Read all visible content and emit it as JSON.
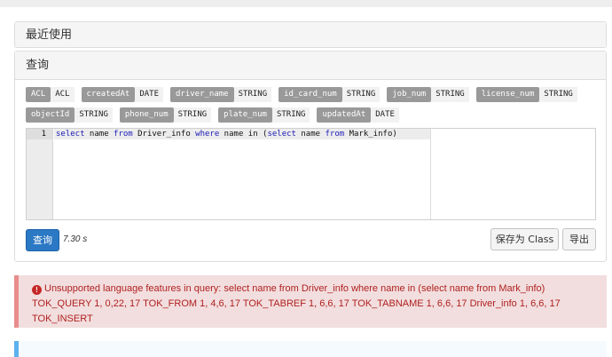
{
  "recent": {
    "title": "最近使用"
  },
  "query": {
    "title": "查询",
    "fields": [
      [
        {
          "name": "ACL",
          "type": "ACL"
        },
        {
          "name": "createdAt",
          "type": "DATE"
        },
        {
          "name": "driver_name",
          "type": "STRING"
        },
        {
          "name": "id_card_num",
          "type": "STRING"
        },
        {
          "name": "job_num",
          "type": "STRING"
        },
        {
          "name": "license_num",
          "type": "STRING"
        }
      ],
      [
        {
          "name": "objectId",
          "type": "STRING"
        },
        {
          "name": "phone_num",
          "type": "STRING"
        },
        {
          "name": "plate_num",
          "type": "STRING"
        },
        {
          "name": "updatedAt",
          "type": "DATE"
        }
      ]
    ],
    "editor": {
      "line_number": "1",
      "tokens": [
        {
          "t": "select",
          "kw": true
        },
        {
          "t": " name ",
          "kw": false
        },
        {
          "t": "from",
          "kw": true
        },
        {
          "t": " Driver_info ",
          "kw": false
        },
        {
          "t": "where",
          "kw": true
        },
        {
          "t": " name in (",
          "kw": false
        },
        {
          "t": "select",
          "kw": true
        },
        {
          "t": " name ",
          "kw": false
        },
        {
          "t": "from",
          "kw": true
        },
        {
          "t": " Mark_info)",
          "kw": false
        }
      ]
    },
    "run_label": "查询",
    "elapsed": "7.30 s",
    "save_label": "保存为 Class",
    "export_label": "导出"
  },
  "error": {
    "icon": "exclamation-circle-icon",
    "message": "Unsupported language features in query: select name from Driver_info where name in (select name from Mark_info) TOK_QUERY 1, 0,22, 17 TOK_FROM 1, 4,6, 17 TOK_TABREF 1, 6,6, 17 TOK_TABNAME 1, 6,6, 17 Driver_info 1, 6,6, 17 TOK_INSERT"
  },
  "colors": {
    "primary": "#2b78c4",
    "error_text": "#b12020",
    "error_bg": "#f2dede",
    "info_border": "#5bb2ee"
  }
}
